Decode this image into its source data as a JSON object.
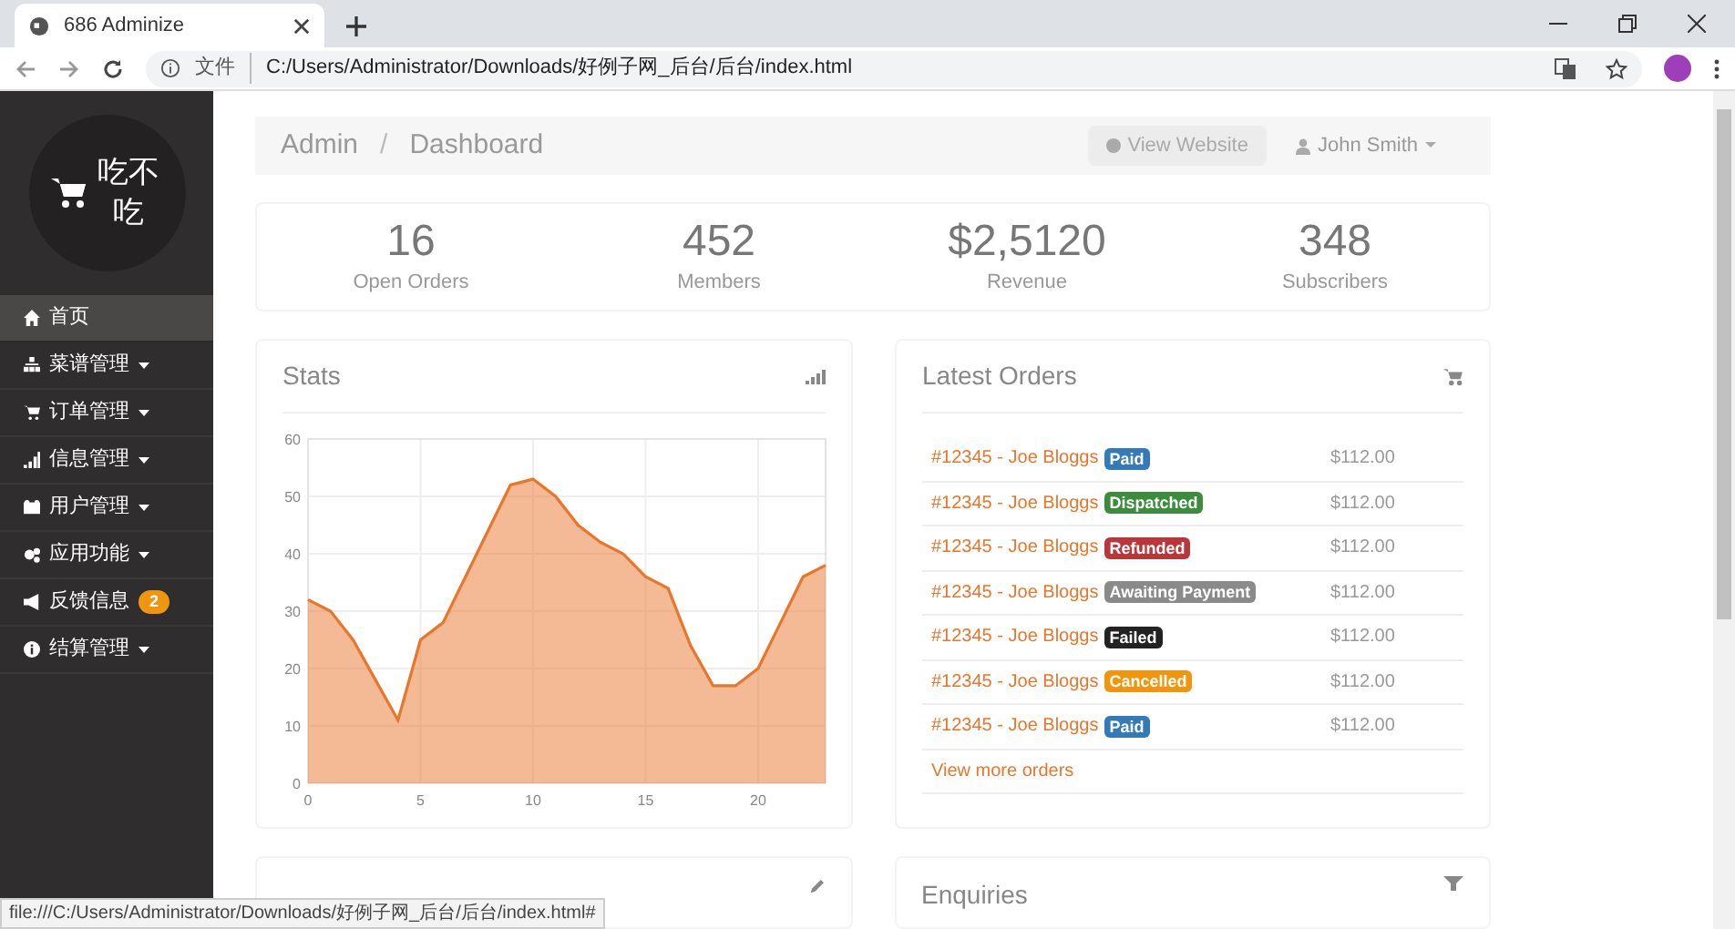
{
  "browser": {
    "tab_title": "686 Adminize",
    "address_label": "文件",
    "url": "C:/Users/Administrator/Downloads/好例子网_后台/后台/index.html",
    "status_url": "file:///C:/Users/Administrator/Downloads/好例子网_后台/后台/index.html#"
  },
  "logo": {
    "text": "吃不吃"
  },
  "sidebar": {
    "items": [
      {
        "label": "首页",
        "selected": true,
        "dropdown": false
      },
      {
        "label": "菜谱管理",
        "selected": false,
        "dropdown": true
      },
      {
        "label": "订单管理",
        "selected": false,
        "dropdown": true
      },
      {
        "label": "信息管理",
        "selected": false,
        "dropdown": true
      },
      {
        "label": "用户管理",
        "selected": false,
        "dropdown": true
      },
      {
        "label": "应用功能",
        "selected": false,
        "dropdown": true
      },
      {
        "label": "反馈信息",
        "selected": false,
        "dropdown": false,
        "badge": "2"
      },
      {
        "label": "结算管理",
        "selected": false,
        "dropdown": true
      }
    ]
  },
  "breadcrumb": [
    "Admin",
    "Dashboard"
  ],
  "breadcrumb_separator": "/",
  "header_buttons": {
    "view_website": "View Website",
    "user": "John Smith"
  },
  "stats": [
    {
      "value": "16",
      "label": "Open Orders"
    },
    {
      "value": "452",
      "label": "Members"
    },
    {
      "value": "$2,5120",
      "label": "Revenue"
    },
    {
      "value": "348",
      "label": "Subscribers"
    }
  ],
  "stats_card": {
    "title": "Stats",
    "chart_data": {
      "type": "area",
      "x": [
        0,
        1,
        2,
        3,
        4,
        5,
        6,
        7,
        8,
        9,
        10,
        11,
        12,
        13,
        14,
        15,
        16,
        17,
        18,
        19,
        20,
        21,
        22,
        23
      ],
      "grid": true,
      "series": [
        {
          "color": "#e8762b",
          "values": [
            32,
            30,
            25,
            18,
            11,
            25,
            28,
            36,
            44,
            52,
            53,
            50,
            45,
            42,
            40,
            36,
            34,
            24,
            17,
            17,
            20,
            28,
            36,
            38
          ]
        }
      ],
      "xlim": [
        0,
        23
      ],
      "ylim": [
        0,
        60
      ],
      "xticks": [
        0,
        5,
        10,
        15,
        20
      ],
      "yticks": [
        0,
        10,
        20,
        30,
        40,
        50,
        60
      ]
    }
  },
  "orders_card": {
    "title": "Latest Orders",
    "orders": [
      {
        "name": "#12345 - Joe Bloggs",
        "status": "Paid",
        "color": "#337ab7",
        "amount": "$112.00"
      },
      {
        "name": "#12345 - Joe Bloggs",
        "status": "Dispatched",
        "color": "#3d8b3d",
        "amount": "$112.00"
      },
      {
        "name": "#12345 - Joe Bloggs",
        "status": "Refunded",
        "color": "#b9373a",
        "amount": "$112.00"
      },
      {
        "name": "#12345 - Joe Bloggs",
        "status": "Awaiting Payment",
        "color": "#8a8a8a",
        "amount": "$112.00"
      },
      {
        "name": "#12345 - Joe Bloggs",
        "status": "Failed",
        "color": "#222222",
        "amount": "$112.00"
      },
      {
        "name": "#12345 - Joe Bloggs",
        "status": "Cancelled",
        "color": "#f0960e",
        "amount": "$112.00"
      },
      {
        "name": "#12345 - Joe Bloggs",
        "status": "Paid",
        "color": "#337ab7",
        "amount": "$112.00"
      }
    ],
    "more_link": "View more orders"
  },
  "enquiries_card": {
    "title": "Enquiries"
  }
}
